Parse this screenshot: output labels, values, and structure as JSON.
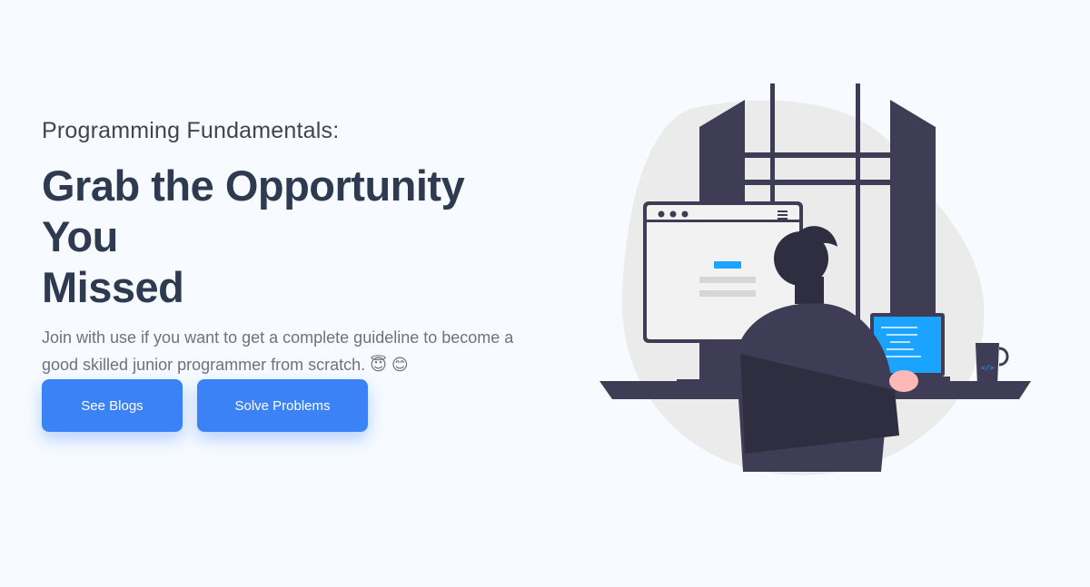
{
  "hero": {
    "eyebrow": "Programming Fundamentals:",
    "headline_line1": "Grab the Opportunity You",
    "headline_line2": "Missed",
    "description": "Join with use if you want to get a complete guideline to become a good skilled junior programmer from scratch.",
    "emojis": "😇 😊"
  },
  "buttons": {
    "see_blogs": "See Blogs",
    "solve_problems": "Solve Problems"
  },
  "illustration": {
    "name": "developer-at-desk-illustration"
  },
  "colors": {
    "background": "#f7fbff",
    "primary": "#3b82f6",
    "headline": "#2d3a4f",
    "dark": "#3f3d56"
  }
}
